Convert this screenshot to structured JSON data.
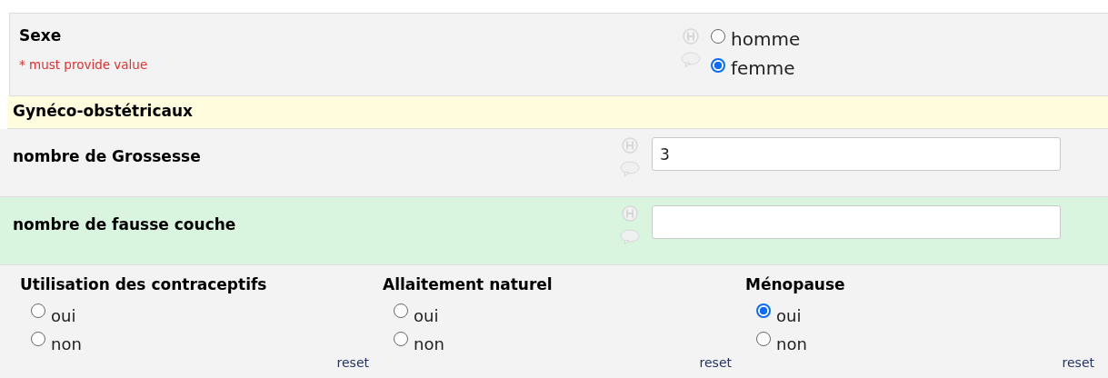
{
  "fields": [
    {
      "kind": "radio",
      "label": "Sexe",
      "note": "* must provide value",
      "highlighted": false,
      "options": [
        {
          "label": "homme",
          "selected": false
        },
        {
          "label": "femme",
          "selected": true
        }
      ]
    },
    {
      "kind": "section",
      "label": "Gynéco-obstétricaux"
    },
    {
      "kind": "text",
      "label": "nombre de Grossesse",
      "value": "3",
      "highlighted": false
    },
    {
      "kind": "text",
      "label": "nombre de fausse couche",
      "highlighted": true
    }
  ],
  "matrix": [
    {
      "label": "Utilisation des contraceptifs",
      "options": [
        {
          "label": "oui",
          "selected": false
        },
        {
          "label": "non",
          "selected": false
        }
      ],
      "reset": "reset"
    },
    {
      "label": "Allaitement naturel",
      "options": [
        {
          "label": "oui",
          "selected": false
        },
        {
          "label": "non",
          "selected": false
        }
      ],
      "reset": "reset"
    },
    {
      "label": "Ménopause",
      "options": [
        {
          "label": "oui",
          "selected": true
        },
        {
          "label": "non",
          "selected": false
        }
      ],
      "reset": "reset"
    }
  ]
}
